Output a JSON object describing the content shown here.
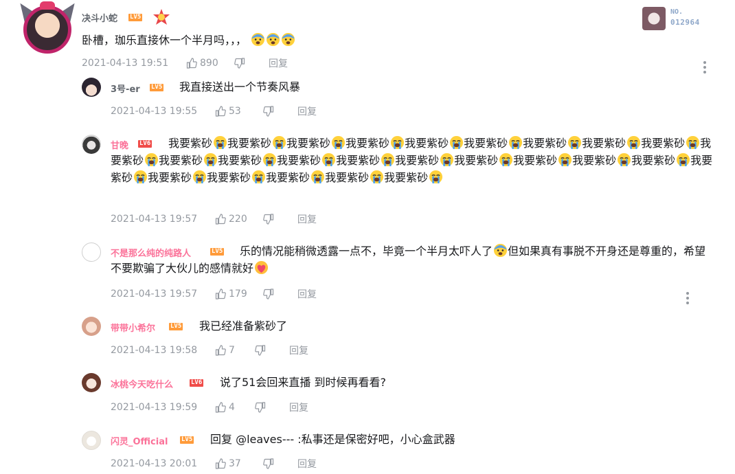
{
  "main_comment": {
    "username": "决斗小蛇",
    "level": "LV5",
    "text": "卧槽，珈乐直接休一个半月吗，，，",
    "time": "2021-04-13 19:51",
    "likes": "890",
    "reply_label": "回复",
    "fan_badge": {
      "no_label": "NO.",
      "number": "012964"
    }
  },
  "replies": [
    {
      "username": "3号-er",
      "level": "LV5",
      "text": "我直接送出一个节奏风暴",
      "time": "2021-04-13 19:55",
      "likes": "53",
      "reply_label": "回复"
    },
    {
      "username": "甘晚",
      "level": "LV6",
      "text_unit": "我要紫砂",
      "repeat": 25,
      "time": "2021-04-13 19:57",
      "likes": "220",
      "reply_label": "回复"
    },
    {
      "username": "不是那么纯的纯路人",
      "level": "LV5",
      "text_a": "乐的情况能稍微透露一点不，毕竟一个半月太吓人了",
      "text_b": "但如果真有事脱不开身还是尊",
      "text_c": "重的，希望不要欺骗了大伙儿的感情就好",
      "time": "2021-04-13 19:57",
      "likes": "179",
      "reply_label": "回复"
    },
    {
      "username": "带带小希尔",
      "level": "LV5",
      "text": "我已经准备紫砂了",
      "time": "2021-04-13 19:58",
      "likes": "7",
      "reply_label": "回复"
    },
    {
      "username": "冰桃今天吃什么",
      "level": "LV6",
      "text": "说了51会回来直播 到时候再看看?",
      "time": "2021-04-13 19:59",
      "likes": "4",
      "reply_label": "回复"
    },
    {
      "username": "闪灵_Official",
      "level": "LV5",
      "text": "回复 @leaves--- :私事还是保密好吧，小心盒武器",
      "time": "2021-04-13 20:01",
      "likes": "37",
      "reply_label": "回复"
    }
  ],
  "colors": {
    "pink_name": "#fb7299",
    "lv5": "#ff9b3a",
    "lv6": "#f04c49",
    "meta": "#9499a0"
  }
}
